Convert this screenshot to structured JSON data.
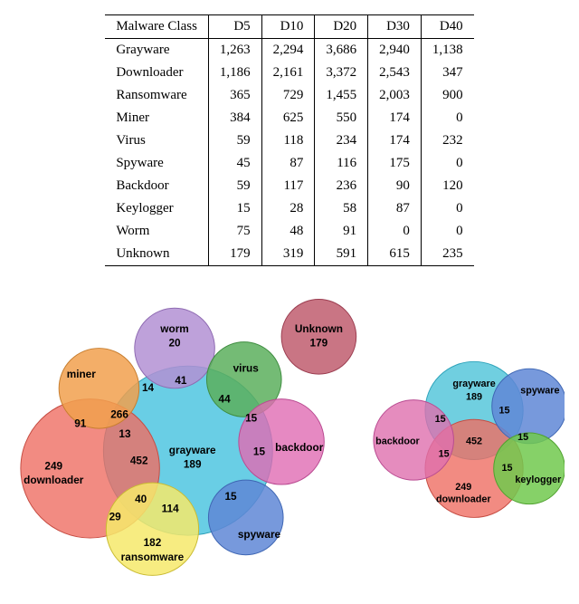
{
  "table": {
    "headers": [
      "Malware Class",
      "D5",
      "D10",
      "D20",
      "D30",
      "D40"
    ],
    "rows": [
      {
        "name": "Grayware",
        "D5": "1,263",
        "D10": "2,294",
        "D20": "3,686",
        "D30": "2,940",
        "D40": "1,138"
      },
      {
        "name": "Downloader",
        "D5": "1,186",
        "D10": "2,161",
        "D20": "3,372",
        "D30": "2,543",
        "D40": "347"
      },
      {
        "name": "Ransomware",
        "D5": "365",
        "D10": "729",
        "D20": "1,455",
        "D30": "2,003",
        "D40": "900"
      },
      {
        "name": "Miner",
        "D5": "384",
        "D10": "625",
        "D20": "550",
        "D30": "174",
        "D40": "0"
      },
      {
        "name": "Virus",
        "D5": "59",
        "D10": "118",
        "D20": "234",
        "D30": "174",
        "D40": "232"
      },
      {
        "name": "Spyware",
        "D5": "45",
        "D10": "87",
        "D20": "116",
        "D30": "175",
        "D40": "0"
      },
      {
        "name": "Backdoor",
        "D5": "59",
        "D10": "117",
        "D20": "236",
        "D30": "90",
        "D40": "120"
      },
      {
        "name": "Keylogger",
        "D5": "15",
        "D10": "28",
        "D20": "58",
        "D30": "87",
        "D40": "0"
      },
      {
        "name": "Worm",
        "D5": "75",
        "D10": "48",
        "D20": "91",
        "D30": "0",
        "D40": "0"
      },
      {
        "name": "Unknown",
        "D5": "179",
        "D10": "319",
        "D20": "591",
        "D30": "615",
        "D40": "235"
      }
    ]
  },
  "chart_data": [
    {
      "type": "venn",
      "title": "Left Venn (sample counts and overlaps)",
      "sets": [
        {
          "name": "grayware",
          "color": "#4fc6e0",
          "count": 189
        },
        {
          "name": "downloader",
          "color": "#ef6e63",
          "count": 249
        },
        {
          "name": "ransomware",
          "color": "#f6e96b",
          "count": 182
        },
        {
          "name": "miner",
          "color": "#f1a04e",
          "count": null
        },
        {
          "name": "worm",
          "color": "#b390d4",
          "count": 20
        },
        {
          "name": "virus",
          "color": "#5caf5d",
          "count": null
        },
        {
          "name": "backdoor",
          "color": "#e06bb3",
          "count": null
        },
        {
          "name": "spyware",
          "color": "#5f87d6",
          "count": 15
        },
        {
          "name": "Unknown",
          "color": "#c05d6f",
          "count": 179
        }
      ],
      "intersections": [
        {
          "sets": [
            "grayware",
            "downloader"
          ],
          "count": 452
        },
        {
          "sets": [
            "grayware",
            "miner"
          ],
          "count": 266
        },
        {
          "sets": [
            "grayware",
            "ransomware"
          ],
          "count": 114
        },
        {
          "sets": [
            "grayware",
            "downloader",
            "ransomware"
          ],
          "count": 40
        },
        {
          "sets": [
            "grayware",
            "worm"
          ],
          "count": 41
        },
        {
          "sets": [
            "grayware",
            "virus"
          ],
          "count": 44
        },
        {
          "sets": [
            "grayware",
            "backdoor"
          ],
          "count": 15
        },
        {
          "sets": [
            "grayware",
            "spyware"
          ],
          "count": 15
        },
        {
          "sets": [
            "grayware",
            "virus",
            "backdoor"
          ],
          "count": 15
        },
        {
          "sets": [
            "grayware",
            "miner",
            "worm"
          ],
          "count": 14
        },
        {
          "sets": [
            "grayware",
            "miner",
            "downloader"
          ],
          "count": 13
        },
        {
          "sets": [
            "downloader",
            "miner"
          ],
          "count": 91
        },
        {
          "sets": [
            "downloader",
            "ransomware"
          ],
          "count": 29
        }
      ]
    },
    {
      "type": "venn",
      "title": "Right Venn (sample counts and overlaps)",
      "sets": [
        {
          "name": "grayware",
          "color": "#57c7da",
          "count": 189
        },
        {
          "name": "downloader",
          "color": "#ef6e63",
          "count": 249
        },
        {
          "name": "backdoor",
          "color": "#de6fae",
          "count": null
        },
        {
          "name": "spyware",
          "color": "#5f87d6",
          "count": null
        },
        {
          "name": "keylogger",
          "color": "#71c94d",
          "count": null
        }
      ],
      "intersections": [
        {
          "sets": [
            "grayware",
            "downloader"
          ],
          "count": 452
        },
        {
          "sets": [
            "grayware",
            "backdoor"
          ],
          "count": 15
        },
        {
          "sets": [
            "grayware",
            "spyware"
          ],
          "count": 15
        },
        {
          "sets": [
            "grayware",
            "downloader",
            "backdoor"
          ],
          "count": 15
        },
        {
          "sets": [
            "spyware",
            "keylogger"
          ],
          "count": 15
        },
        {
          "sets": [
            "downloader",
            "keylogger"
          ],
          "count": 15
        }
      ]
    }
  ],
  "colors": {
    "grayware": "#4fc6e0",
    "downloader": "#ef6e63",
    "ransomware": "#f6e96b",
    "miner": "#f1a04e",
    "worm": "#b390d4",
    "virus": "#5caf5d",
    "backdoor": "#e06bb3",
    "spyware": "#5f87d6",
    "keylogger": "#71c94d",
    "unknown": "#c05d6f"
  },
  "labels": {
    "left": {
      "worm": "worm",
      "worm_v": "20",
      "miner": "miner",
      "virus": "virus",
      "unknown": "Unknown",
      "unknown_v": "179",
      "downloader": "downloader",
      "downloader_v": "249",
      "grayware": "grayware",
      "grayware_v": "189",
      "backdoor": "backdoor",
      "spyware": "spyware",
      "spyware_v": "15",
      "ransomware": "ransomware",
      "ransomware_v": "182",
      "i_dl_miner": "91",
      "i_gw_miner": "266",
      "i_gw_dl": "452",
      "i_gw_miner_worm": "14",
      "i_gw_miner_dl": "13",
      "i_gw_worm": "41",
      "i_gw_virus": "44",
      "i_gw_virus_bd": "15",
      "i_gw_bd": "15",
      "i_gw_spy": "15",
      "i_gw_ransom": "114",
      "i_gw_dl_ransom": "40",
      "i_dl_ransom": "29"
    },
    "right": {
      "grayware": "grayware",
      "grayware_v": "189",
      "downloader": "downloader",
      "downloader_v": "249",
      "backdoor": "backdoor",
      "spyware": "spyware",
      "keylogger": "keylogger",
      "i_gw_dl": "452",
      "i_gw_bd": "15",
      "i_gw_spy": "15",
      "i_gw_dl_bd": "15",
      "i_spy_key": "15",
      "i_dl_key": "15"
    }
  }
}
